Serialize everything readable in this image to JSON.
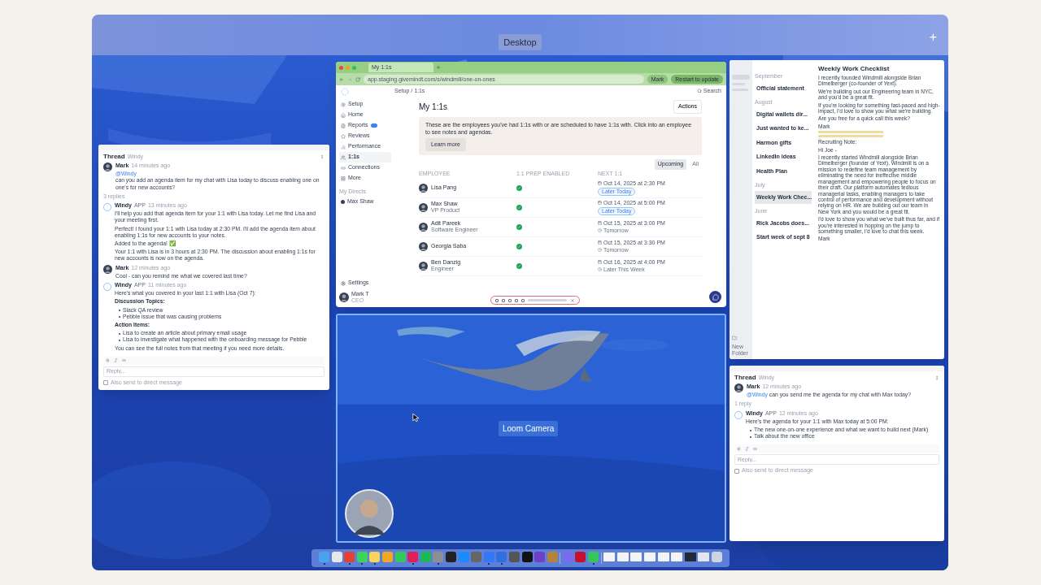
{
  "top_bar": {
    "space_label": "Desktop",
    "add_symbol": "+"
  },
  "browser": {
    "tab": "My 1:1s",
    "url": "app.staging.givemindt.com/s/windmill/one-on-ones",
    "profile": "Mark",
    "update_button": "Restart to update",
    "sidebar": [
      {
        "label": "Setup",
        "selected": false,
        "badge": false
      },
      {
        "label": "Home",
        "selected": false,
        "badge": false
      },
      {
        "label": "Reports",
        "selected": false,
        "badge": true
      },
      {
        "label": "Reviews",
        "selected": false,
        "badge": false
      },
      {
        "label": "Performance",
        "selected": false,
        "badge": false
      },
      {
        "label": "1:1s",
        "selected": true,
        "badge": false
      },
      {
        "label": "Connections",
        "selected": false,
        "badge": false
      },
      {
        "label": "More",
        "selected": false,
        "badge": false
      }
    ],
    "directs_heading": "My Directs",
    "directs": [
      "Max Shaw"
    ],
    "settings": "Settings",
    "user_name": "Mark T",
    "user_role": "CEO",
    "breadcrumb": "Setup / 1:1s",
    "search": "Search",
    "title": "My 1:1s",
    "actions": "Actions",
    "banner": "These are the employees you've had 1:1s with or are scheduled to have 1:1s with. Click into an employee to see notes and agendas.",
    "learn_more": "Learn more",
    "filters": [
      {
        "label": "Upcoming",
        "selected": true
      },
      {
        "label": "All",
        "selected": false
      }
    ],
    "columns": [
      "EMPLOYEE",
      "1:1 PREP ENABLED",
      "NEXT 1:1"
    ],
    "rows": [
      {
        "name": "Lisa Pang",
        "role": "",
        "prep_enabled": true,
        "date": "Oct 14, 2025 at 2:30 PM",
        "when": "Later Today",
        "highlighted": true
      },
      {
        "name": "Max Shaw",
        "role": "VP Product",
        "prep_enabled": true,
        "date": "Oct 14, 2025 at 5:00 PM",
        "when": "Later Today",
        "highlighted": true
      },
      {
        "name": "Adit Pareek",
        "role": "Software Engineer",
        "prep_enabled": true,
        "date": "Oct 15, 2025 at 3:00 PM",
        "when": "Tomorrow",
        "highlighted": false
      },
      {
        "name": "Georgia Saba",
        "role": "",
        "prep_enabled": true,
        "date": "Oct 15, 2025 at 3:30 PM",
        "when": "Tomorrow",
        "highlighted": false
      },
      {
        "name": "Ben Danzig",
        "role": "Engineer",
        "prep_enabled": true,
        "date": "Oct 16, 2025 at 4:00 PM",
        "when": "Later This Week",
        "highlighted": false
      }
    ]
  },
  "thread_left": {
    "title": "Thread",
    "subtitle": "Windy",
    "reply_count": "3 replies",
    "reply_placeholder": "Reply...",
    "also_send": "Also send to direct message",
    "also_send_checked": false,
    "messages": [
      {
        "kind": "user",
        "name": "Mark",
        "time": "14 minutes ago",
        "mention": "@Windy",
        "blocks": [
          {
            "kind": "text",
            "text": "can you add an agenda item for my chat with Lisa today to discuss enabling one on one's for new accounts?"
          }
        ]
      },
      {
        "kind": "bot",
        "name": "Windy",
        "tag": "APP",
        "time": "13 minutes ago",
        "blocks": [
          {
            "kind": "text",
            "text": "I'll help you add that agenda item for your 1:1 with Lisa today. Let me find Lisa and your meeting first."
          },
          {
            "kind": "text",
            "text": "Perfect! I found your 1:1 with Lisa today at 2:30 PM. I'll add the agenda item about enabling 1:1s for new accounts to your notes."
          },
          {
            "kind": "text",
            "text": "Added to the agenda! ✅"
          },
          {
            "kind": "text",
            "text": "Your 1:1 with Lisa is in 3 hours at 2:30 PM. The discussion about enabling 1:1s for new accounts is now on the agenda."
          }
        ]
      },
      {
        "kind": "user",
        "name": "Mark",
        "time": "12 minutes ago",
        "blocks": [
          {
            "kind": "text",
            "text": "Cool - can you remind me what we covered last time?"
          }
        ]
      },
      {
        "kind": "bot",
        "name": "Windy",
        "tag": "APP",
        "time": "11 minutes ago",
        "blocks": [
          {
            "kind": "text",
            "text": "Here's what you covered in your last 1:1 with Lisa (Oct 7):"
          },
          {
            "kind": "heading",
            "text": "Discussion Topics:"
          },
          {
            "kind": "bullets",
            "items": [
              "Slack QA review",
              "Pebble issue that was causing problems"
            ]
          },
          {
            "kind": "heading",
            "text": "Action Items:"
          },
          {
            "kind": "bullets",
            "items": [
              "Lisa to create an article about primary email usage",
              "Lisa to investigate what happened with the onboarding message for Pebble"
            ]
          },
          {
            "kind": "text",
            "text": "You can see the full notes from that meeting if you need more details."
          }
        ]
      }
    ]
  },
  "notes": {
    "new_folder": "New Folder",
    "sections": [
      {
        "heading": "September",
        "items": [
          {
            "title": "Official statement",
            "selected": false
          }
        ]
      },
      {
        "heading": "August",
        "items": [
          {
            "title": "Digital wallets dir...",
            "selected": false
          },
          {
            "title": "Just wanted to ke...",
            "selected": false
          },
          {
            "title": "Harmon gifts",
            "selected": false
          },
          {
            "title": "LinkedIn ideas",
            "selected": false
          },
          {
            "title": "Health Plan",
            "selected": false
          }
        ]
      },
      {
        "heading": "July",
        "items": [
          {
            "title": "Weekly Work Chec...",
            "selected": true
          }
        ]
      },
      {
        "heading": "June",
        "items": [
          {
            "title": "Rick Jacobs does...",
            "selected": false
          },
          {
            "title": "Start week of sept 8",
            "selected": false
          }
        ]
      }
    ],
    "note_title": "Weekly Work Checklist",
    "note_blocks": [
      {
        "kind": "text",
        "text": "I recently founded Windmill alongside Brian Dimelberger (co-founder of Yext)."
      },
      {
        "kind": "text",
        "text": "We're building out our Engineering team in NYC, and you'd be a great fit."
      },
      {
        "kind": "text",
        "text": "If you're looking for something fast-paced and high-impact, I'd love to show you what we're building."
      },
      {
        "kind": "text",
        "text": "Are you free for a quick call this week?"
      },
      {
        "kind": "text",
        "text": "Mark"
      },
      {
        "kind": "highlight"
      },
      {
        "kind": "highlight"
      },
      {
        "kind": "text",
        "text": "Recruiting Note:"
      },
      {
        "kind": "text",
        "text": "Hi Joe -"
      },
      {
        "kind": "text",
        "text": "I recently started Windmill alongside Brian Dimelberger (founder of Yext). Windmill is on a mission to redefine team management by eliminating the need for ineffective middle management and empowering people to focus on their craft. Our platform automates tedious managerial tasks, enabling managers to take control of performance and development without relying on HR. We are building out our team in New York and you would be a great fit."
      },
      {
        "kind": "text",
        "text": "I'd love to show you what we've built thus far, and if you're interested in hopping on the jump to something smaller, I'd love to chat this week."
      },
      {
        "kind": "text",
        "text": "Mark"
      }
    ]
  },
  "thread_right": {
    "title": "Thread",
    "subtitle": "Windy",
    "reply_count": "1 reply",
    "reply_placeholder": "Reply...",
    "also_send": "Also send to direct message",
    "also_send_checked": false,
    "messages": [
      {
        "kind": "user",
        "name": "Mark",
        "time": "12 minutes ago",
        "mention": "@Windy",
        "blocks": [
          {
            "kind": "text",
            "text": "can you send me the agenda for my chat with Max today?"
          }
        ]
      },
      {
        "kind": "bot",
        "name": "Windy",
        "tag": "APP",
        "time": "12 minutes ago",
        "blocks": [
          {
            "kind": "text",
            "text": "Here's the agenda for your 1:1 with Max today at 5:00 PM:"
          },
          {
            "kind": "bullets",
            "items": [
              "The new one-on-one experience and what we want to build next (Mark)",
              "Talk about the new office"
            ]
          }
        ]
      }
    ]
  },
  "loom": {
    "label": "Loom Camera"
  },
  "dock": [
    {
      "kind": "app",
      "color": "#4aa3f0",
      "running": true
    },
    {
      "kind": "app",
      "color": "#e5e7eb",
      "running": false
    },
    {
      "kind": "app",
      "color": "#e34133",
      "running": true
    },
    {
      "kind": "app",
      "color": "#3ed35a",
      "running": true
    },
    {
      "kind": "app",
      "color": "#f6d55c",
      "running": true
    },
    {
      "kind": "app",
      "color": "#f5a623",
      "running": false
    },
    {
      "kind": "app",
      "color": "#34c759",
      "running": false
    },
    {
      "kind": "app",
      "color": "#e01e5a",
      "running": true
    },
    {
      "kind": "app",
      "color": "#1db954",
      "running": false
    },
    {
      "kind": "app",
      "color": "#8e8e93",
      "running": true
    },
    {
      "kind": "app",
      "color": "#222222",
      "running": false
    },
    {
      "kind": "app",
      "color": "#1a8cff",
      "running": false
    },
    {
      "kind": "app",
      "color": "#666666",
      "running": false
    },
    {
      "kind": "app",
      "color": "#3478f6",
      "running": true
    },
    {
      "kind": "app",
      "color": "#2f6fe0",
      "running": true
    },
    {
      "kind": "app",
      "color": "#555555",
      "running": false
    },
    {
      "kind": "app",
      "color": "#111111",
      "running": false
    },
    {
      "kind": "app",
      "color": "#6e40c9",
      "running": false
    },
    {
      "kind": "app",
      "color": "#b5833a",
      "running": false
    },
    {
      "kind": "separator"
    },
    {
      "kind": "app",
      "color": "#7a6bf0",
      "running": false
    },
    {
      "kind": "app",
      "color": "#c8102e",
      "running": false
    },
    {
      "kind": "app",
      "color": "#34c759",
      "running": true
    },
    {
      "kind": "separator"
    },
    {
      "kind": "window",
      "color": "#f3f4f6",
      "running": false
    },
    {
      "kind": "window",
      "color": "#f3f4f6",
      "running": false
    },
    {
      "kind": "window",
      "color": "#f3f4f6",
      "running": false
    },
    {
      "kind": "window",
      "color": "#f3f4f6",
      "running": false
    },
    {
      "kind": "window",
      "color": "#f3f4f6",
      "running": false
    },
    {
      "kind": "window",
      "color": "#f3f4f6",
      "running": false
    },
    {
      "kind": "window",
      "color": "#1f2937",
      "running": false
    },
    {
      "kind": "window",
      "color": "#e5e7eb",
      "running": false
    },
    {
      "kind": "trash",
      "color": "#cbd5e1",
      "running": false
    }
  ]
}
